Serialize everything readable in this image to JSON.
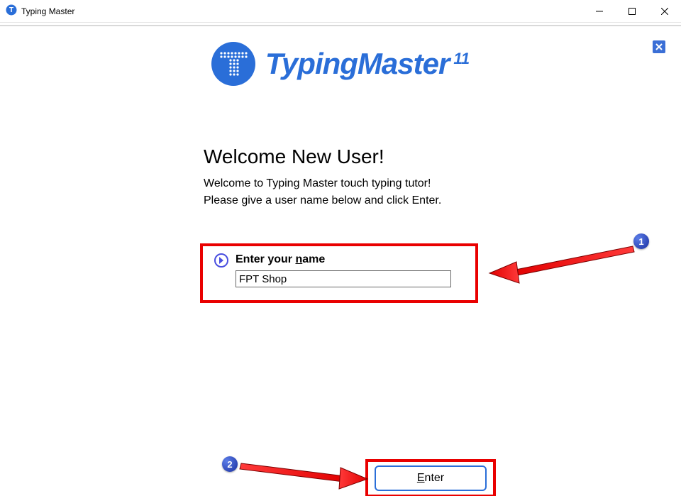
{
  "titlebar": {
    "title": "Typing Master"
  },
  "brand": {
    "name": "TypingMaster",
    "version": "11"
  },
  "welcome": {
    "heading": "Welcome New User!",
    "line1": "Welcome to Typing Master touch typing tutor!",
    "line2": "Please give a user name below and click Enter."
  },
  "name_entry": {
    "label_before": "Enter your ",
    "label_underlined": "n",
    "label_after": "ame",
    "value": "FPT Shop"
  },
  "enter_button": {
    "underlined": "E",
    "rest": "nter"
  },
  "annotations": {
    "step1": "1",
    "step2": "2"
  },
  "colors": {
    "accent": "#2a6ed8",
    "highlight": "#e90000",
    "panel_bg": "#f3f6ff"
  }
}
